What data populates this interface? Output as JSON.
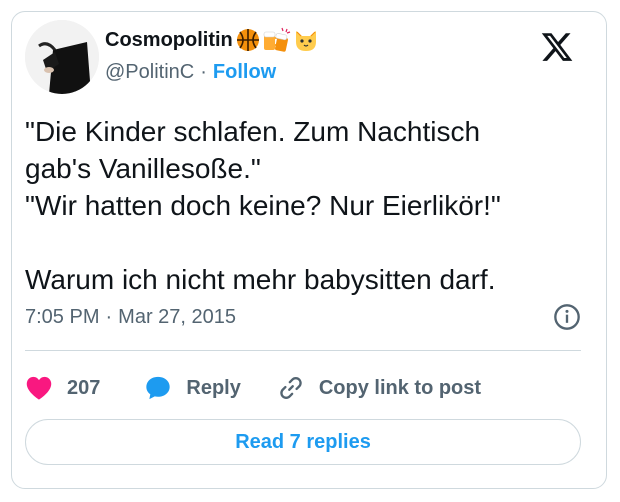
{
  "author": {
    "display_name": "Cosmopolitin",
    "handle": "@PolitinC",
    "follow_label": "Follow",
    "separator": "·",
    "name_emojis": [
      "basketball-emoji",
      "beer-mugs-emoji",
      "cat-face-emoji"
    ]
  },
  "tweet": {
    "lines": [
      "\"Die Kinder schlafen. Zum Nachtisch",
      "gab's Vanillesoße.\"",
      "\"Wir hatten doch keine? Nur Eierlikör!\"",
      "",
      "Warum ich nicht mehr babysitten darf."
    ]
  },
  "meta": {
    "time": "7:05 PM",
    "separator": "·",
    "date": "Mar 27, 2015"
  },
  "actions": {
    "like_count": "207",
    "reply_label": "Reply",
    "copy_label": "Copy link to post"
  },
  "read_replies_label": "Read 7 replies",
  "icons": {
    "logo": "x-logo-icon",
    "info": "info-icon",
    "like": "heart-icon",
    "reply": "speech-bubble-icon",
    "copy": "link-icon"
  },
  "colors": {
    "accent": "#1d9bf0",
    "like": "#f91880",
    "text_primary": "#0f1419",
    "text_secondary": "#536471",
    "border": "#cfd9de"
  }
}
